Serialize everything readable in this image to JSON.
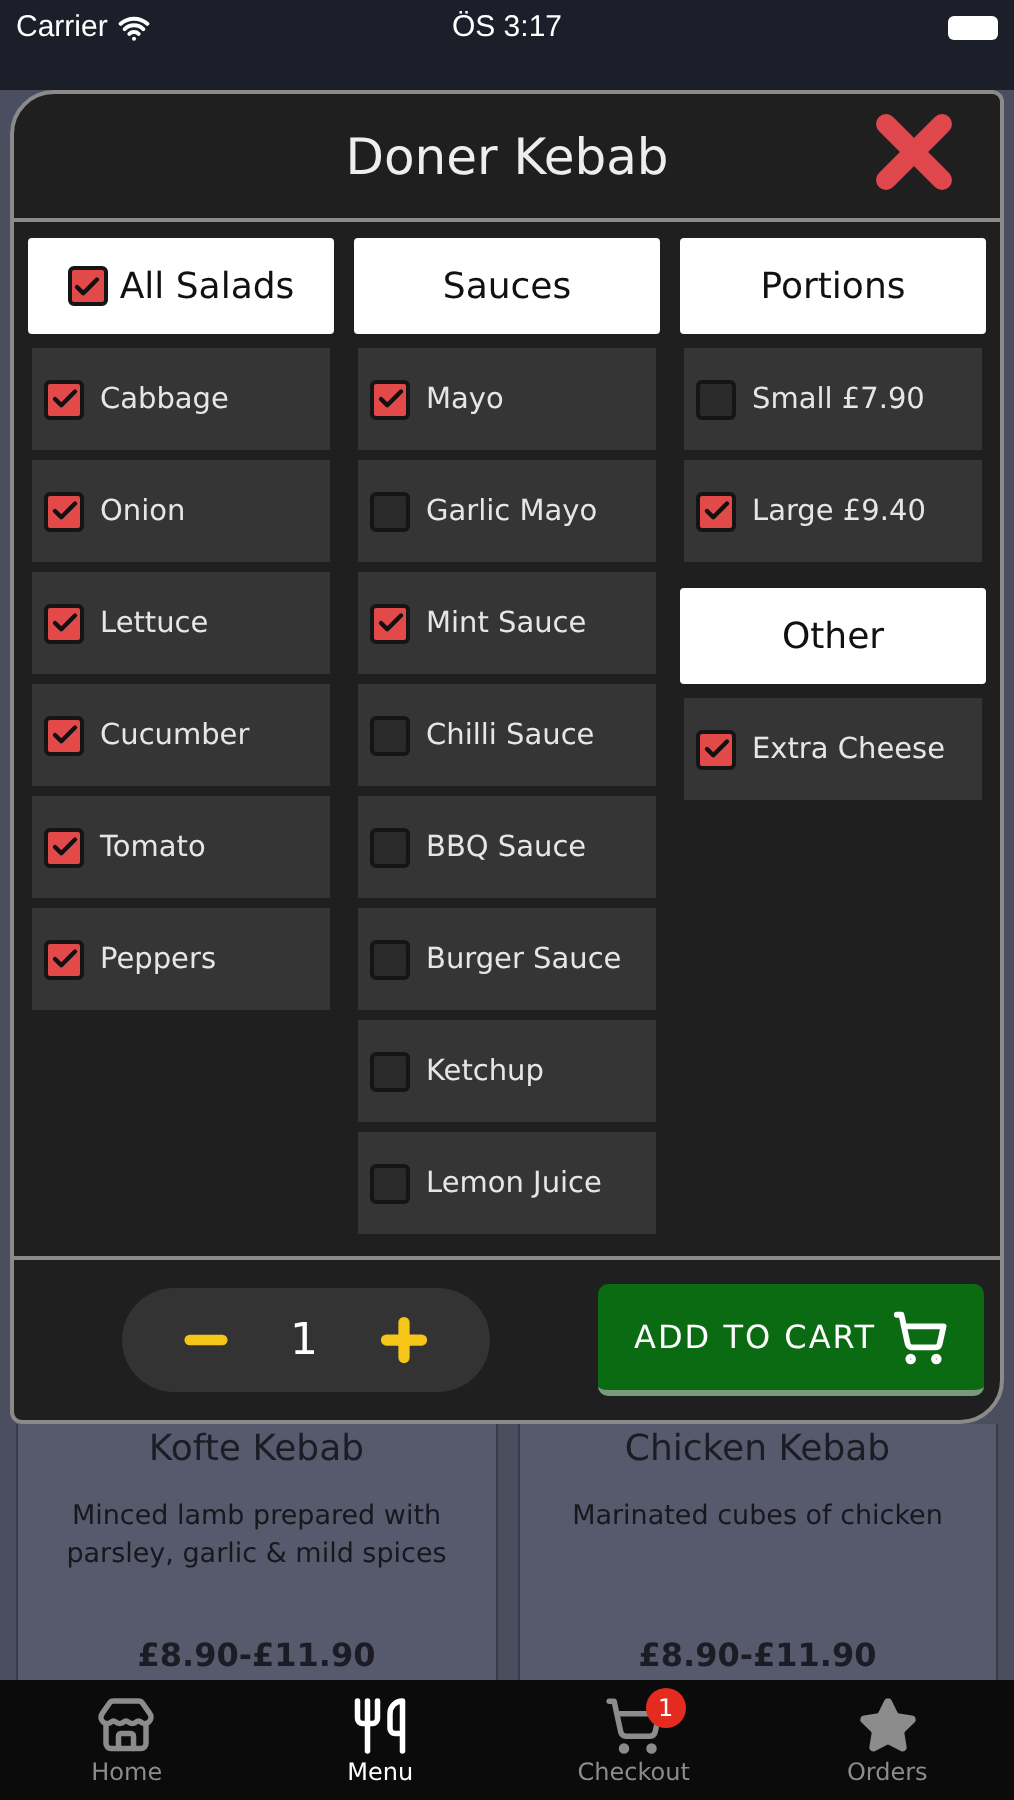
{
  "status_bar": {
    "carrier": "Carrier",
    "time": "ÖS 3:17"
  },
  "modal": {
    "title": "Doner Kebab",
    "columns": [
      {
        "header": {
          "label": "All Salads",
          "checked": true
        },
        "items": [
          {
            "label": "Cabbage",
            "checked": true
          },
          {
            "label": "Onion",
            "checked": true
          },
          {
            "label": "Lettuce",
            "checked": true
          },
          {
            "label": "Cucumber",
            "checked": true
          },
          {
            "label": "Tomato",
            "checked": true
          },
          {
            "label": "Peppers",
            "checked": true
          }
        ]
      },
      {
        "header": {
          "label": "Sauces"
        },
        "items": [
          {
            "label": "Mayo",
            "checked": true
          },
          {
            "label": "Garlic Mayo",
            "checked": false
          },
          {
            "label": "Mint Sauce",
            "checked": true
          },
          {
            "label": "Chilli Sauce",
            "checked": false
          },
          {
            "label": "BBQ Sauce",
            "checked": false
          },
          {
            "label": "Burger Sauce",
            "checked": false
          },
          {
            "label": "Ketchup",
            "checked": false
          },
          {
            "label": "Lemon Juice",
            "checked": false
          }
        ]
      },
      {
        "sections": [
          {
            "header": {
              "label": "Portions"
            },
            "items": [
              {
                "label": "Small £7.90",
                "checked": false
              },
              {
                "label": "Large £9.40",
                "checked": true
              }
            ]
          },
          {
            "header": {
              "label": "Other"
            },
            "items": [
              {
                "label": "Extra Cheese",
                "checked": true
              }
            ]
          }
        ]
      }
    ],
    "quantity": "1",
    "add_to_cart": "ADD TO CART"
  },
  "menu_cards": [
    {
      "title": "Kofte Kebab",
      "description": "Minced lamb prepared with parsley, garlic & mild spices",
      "price": "£8.90-£11.90"
    },
    {
      "title": "Chicken Kebab",
      "description": "Marinated cubes of chicken",
      "price": "£8.90-£11.90"
    }
  ],
  "tab_bar": [
    {
      "label": "Home",
      "selected": false
    },
    {
      "label": "Menu",
      "selected": true
    },
    {
      "label": "Checkout",
      "selected": false,
      "badge": "1"
    },
    {
      "label": "Orders",
      "selected": false
    }
  ]
}
